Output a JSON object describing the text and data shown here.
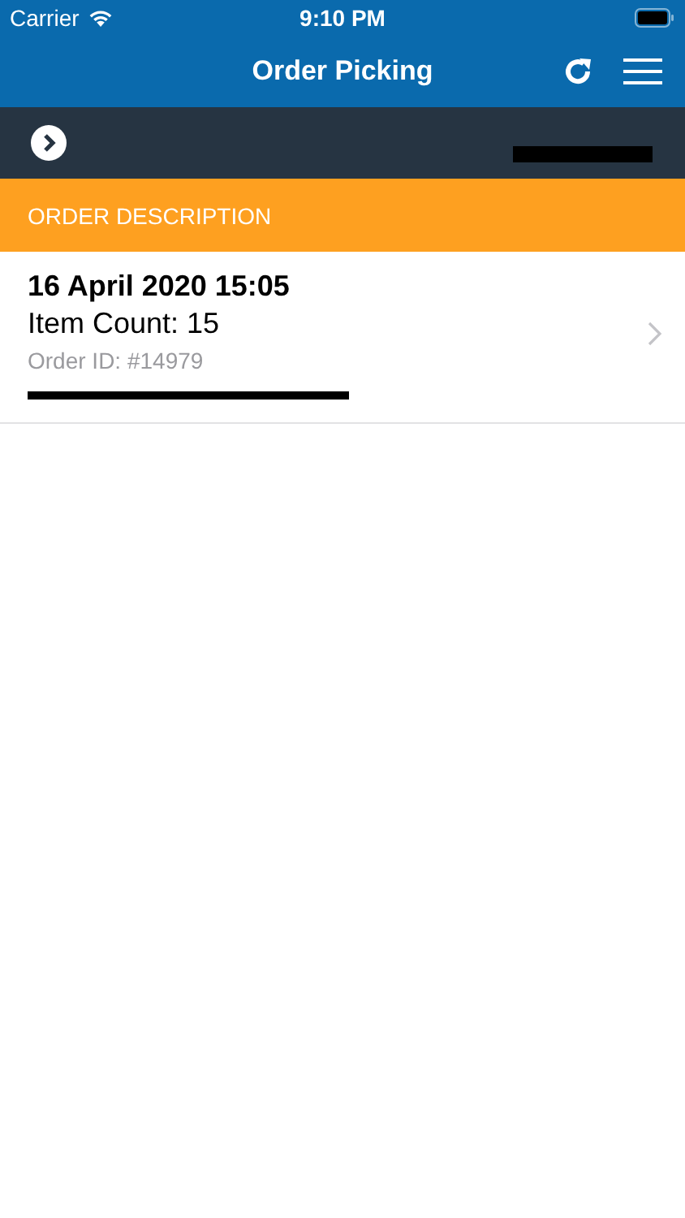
{
  "status_bar": {
    "carrier": "Carrier",
    "time": "9:10 PM"
  },
  "nav_bar": {
    "title": "Order Picking"
  },
  "section_header": {
    "title": "ORDER DESCRIPTION"
  },
  "orders": [
    {
      "date": "16 April 2020 15:05",
      "item_count": "Item Count: 15",
      "order_id": "Order ID: #14979"
    }
  ]
}
